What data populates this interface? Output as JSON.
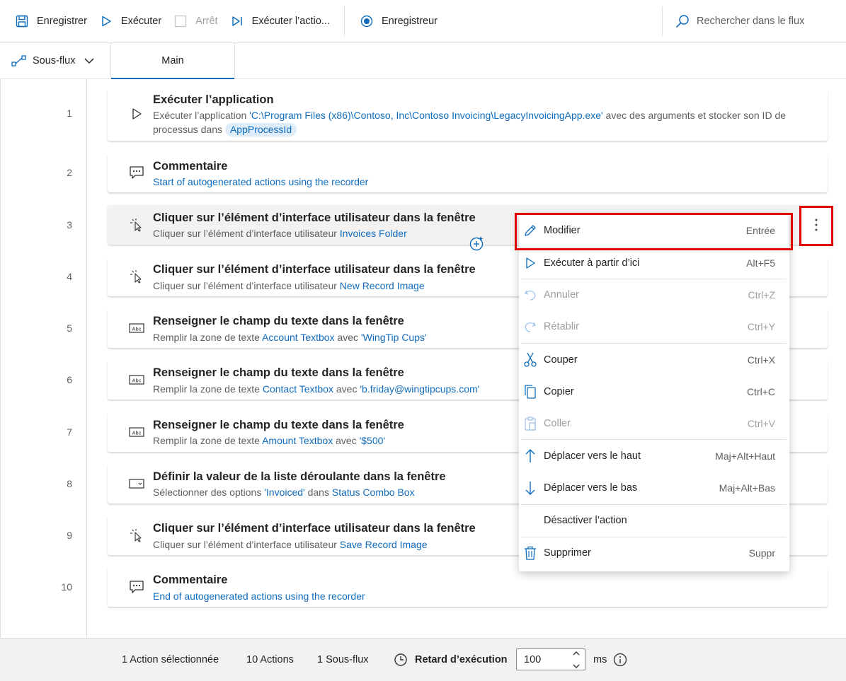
{
  "toolbar": {
    "save_label": "Enregistrer",
    "run_label": "Exécuter",
    "stop_label": "Arrêt",
    "run_action_label": "Exécuter l’actio...",
    "recorder_label": "Enregistreur",
    "search_placeholder": "Rechercher dans le flux"
  },
  "tabs": {
    "subflows_label": "Sous-flux",
    "main_label": "Main"
  },
  "actions": [
    {
      "num": "1",
      "title": "Exécuter l’application",
      "desc_pre": "Exécuter l’application ",
      "desc_link": "'C:\\Program Files (x86)\\Contoso, Inc\\Contoso Invoicing\\LegacyInvoicingApp.exe'",
      "desc_mid": " avec des arguments  et stocker son ID de processus dans ",
      "desc_pill": "AppProcessId"
    },
    {
      "num": "2",
      "title": "Commentaire",
      "desc_link": "Start of autogenerated actions using the recorder"
    },
    {
      "num": "3",
      "title": "Cliquer sur l’élément d’interface utilisateur dans la fenêtre",
      "desc_pre": "Cliquer sur l’élément d’interface utilisateur ",
      "desc_link": "Invoices Folder"
    },
    {
      "num": "4",
      "title": "Cliquer sur l’élément d’interface utilisateur dans la fenêtre",
      "desc_pre": "Cliquer sur l’élément d’interface utilisateur ",
      "desc_link": "New Record Image"
    },
    {
      "num": "5",
      "title": "Renseigner le champ du texte dans la fenêtre",
      "desc_pre": "Remplir la zone de texte ",
      "desc_link": "Account Textbox",
      "desc_mid": " avec ",
      "desc_link2": "'WingTip Cups'"
    },
    {
      "num": "6",
      "title": "Renseigner le champ du texte dans la fenêtre",
      "desc_pre": "Remplir la zone de texte ",
      "desc_link": "Contact Textbox",
      "desc_mid": " avec ",
      "desc_link2": "'b.friday@wingtipcups.com'"
    },
    {
      "num": "7",
      "title": "Renseigner le champ du texte dans la fenêtre",
      "desc_pre": "Remplir la zone de texte ",
      "desc_link": "Amount Textbox",
      "desc_mid": " avec ",
      "desc_link2": "'$500'"
    },
    {
      "num": "8",
      "title": "Définir la valeur de la liste déroulante dans la fenêtre",
      "desc_pre": "Sélectionner des options ",
      "desc_link": "'Invoiced'",
      "desc_mid": " dans ",
      "desc_link2": "Status Combo Box"
    },
    {
      "num": "9",
      "title": "Cliquer sur l’élément d’interface utilisateur dans la fenêtre",
      "desc_pre": "Cliquer sur l’élément d’interface utilisateur ",
      "desc_link": "Save Record Image"
    },
    {
      "num": "10",
      "title": "Commentaire",
      "desc_link": "End of autogenerated actions using the recorder"
    }
  ],
  "menu": {
    "items": [
      {
        "label": "Modifier",
        "key": "Entrée",
        "icon": "pencil-icon"
      },
      {
        "label": "Exécuter à partir d’ici",
        "key": "Alt+F5",
        "icon": "play-icon"
      },
      {
        "label": "Annuler",
        "key": "Ctrl+Z",
        "icon": "undo-icon"
      },
      {
        "label": "Rétablir",
        "key": "Ctrl+Y",
        "icon": "redo-icon"
      },
      {
        "label": "Couper",
        "key": "Ctrl+X",
        "icon": "scissors-icon"
      },
      {
        "label": "Copier",
        "key": "Ctrl+C",
        "icon": "copy-icon"
      },
      {
        "label": "Coller",
        "key": "Ctrl+V",
        "icon": "paste-icon"
      },
      {
        "label": "Déplacer vers le haut",
        "key": "Maj+Alt+Haut",
        "icon": "arrow-up-icon"
      },
      {
        "label": "Déplacer vers le bas",
        "key": "Maj+Alt+Bas",
        "icon": "arrow-down-icon"
      },
      {
        "label": "Désactiver l’action",
        "key": "",
        "icon": ""
      },
      {
        "label": "Supprimer",
        "key": "Suppr",
        "icon": "trash-icon"
      }
    ]
  },
  "status": {
    "selected": "1 Action sélectionnée",
    "actions": "10 Actions",
    "subflows": "1 Sous-flux",
    "delay_label": "Retard d’exécution",
    "delay_value": "100",
    "unit": "ms"
  },
  "colors": {
    "accent": "#0f6cbd",
    "highlight": "#e00000"
  }
}
